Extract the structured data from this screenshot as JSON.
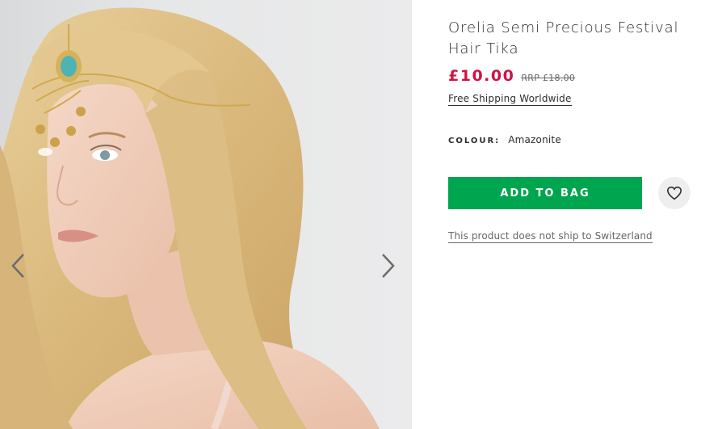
{
  "product": {
    "title": "Orelia Semi Precious Festival Hair Tika",
    "price": "£10.00",
    "rrp": "RRP £18.00",
    "shipping_link": "Free Shipping Worldwide",
    "colour_label": "COLOUR:",
    "colour_value": "Amazonite",
    "add_to_bag_label": "ADD TO BAG",
    "no_ship_notice": "This product does not ship to Switzerland"
  },
  "gallery": {
    "prev_icon": "chevron-left-icon",
    "next_icon": "chevron-right-icon"
  },
  "icons": {
    "wishlist": "heart-icon"
  },
  "colors": {
    "price": "#d01345",
    "add_to_bag_bg": "#00a54f",
    "text": "#2d2d2d"
  }
}
